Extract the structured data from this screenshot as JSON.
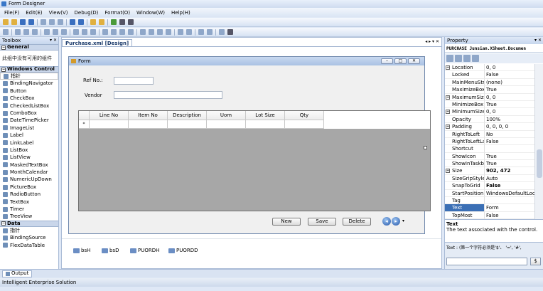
{
  "window": {
    "title": "Form Designer"
  },
  "menu": [
    "File(F)",
    "Edit(E)",
    "View(V)",
    "Debug(D)",
    "Format(O)",
    "Window(W)",
    "Help(H)"
  ],
  "toolbox": {
    "title": "Toolbox",
    "general_label": "General",
    "general_note": "此组中没有可用的组件",
    "windows_control_label": "Windows Control",
    "items": [
      "指针",
      "BindingNavigator",
      "Button",
      "CheckBox",
      "CheckedListBox",
      "ComboBox",
      "DateTimePicker",
      "ImageList",
      "Label",
      "LinkLabel",
      "ListBox",
      "ListView",
      "MaskedTextBox",
      "MonthCalendar",
      "NumericUpDown",
      "PictureBox",
      "RadioButton",
      "TextBox",
      "Timer",
      "TreeView"
    ],
    "data_label": "Data",
    "data_items": [
      "指针",
      "BindingSource",
      "FlexDataTable"
    ]
  },
  "designer": {
    "tab_label": "Purchase.xml [Design]",
    "form": {
      "caption": "Form",
      "refno_label": "Ref No.:",
      "vendor_label": "Vendor",
      "grid_columns": [
        "Line No",
        "Item No",
        "Description",
        "Uom",
        "Lot Size",
        "Qty"
      ],
      "new_row_marker": "*",
      "buttons": {
        "new": "New",
        "save": "Save",
        "delete": "Delete"
      }
    },
    "tray": [
      "bsH",
      "bsD",
      "PUORDH",
      "PUORDD"
    ]
  },
  "properties": {
    "title": "Property",
    "selected_object": "PURCHASE Junsian.XSheet.Documen",
    "rows": [
      {
        "name": "Location",
        "value": "0, 0",
        "expandable": true
      },
      {
        "name": "Locked",
        "value": "False"
      },
      {
        "name": "MainMenuStrip",
        "value": "(none)"
      },
      {
        "name": "MaximizeBox",
        "value": "True"
      },
      {
        "name": "MaximumSize",
        "value": "0, 0",
        "expandable": true
      },
      {
        "name": "MinimizeBox",
        "value": "True"
      },
      {
        "name": "MinimumSize",
        "value": "0, 0",
        "expandable": true
      },
      {
        "name": "Opacity",
        "value": "100%"
      },
      {
        "name": "Padding",
        "value": "0, 0, 0, 0",
        "expandable": true
      },
      {
        "name": "RightToLeft",
        "value": "No"
      },
      {
        "name": "RightToLeftLayout",
        "value": "False"
      },
      {
        "name": "Shortcut",
        "value": ""
      },
      {
        "name": "ShowIcon",
        "value": "True"
      },
      {
        "name": "ShowInTaskbar",
        "value": "True"
      },
      {
        "name": "Size",
        "value": "902, 472",
        "expandable": true,
        "bold": true
      },
      {
        "name": "SizeGripStyle",
        "value": "Auto"
      },
      {
        "name": "SnapToGrid",
        "value": "False",
        "bold": true
      },
      {
        "name": "StartPosition",
        "value": "WindowsDefaultLocation"
      },
      {
        "name": "Tag",
        "value": ""
      },
      {
        "name": "Text",
        "value": "Form",
        "highlight": true
      },
      {
        "name": "TopMost",
        "value": "False"
      }
    ],
    "desc_title": "Text",
    "desc_text": "The text associated with the control.",
    "edit_label": "Text : (第一个字符必须是'$'、 '=', '#',",
    "edit_button": "$"
  },
  "output_tab": "Output",
  "status_text": "Intelligent Enterprise Solution"
}
